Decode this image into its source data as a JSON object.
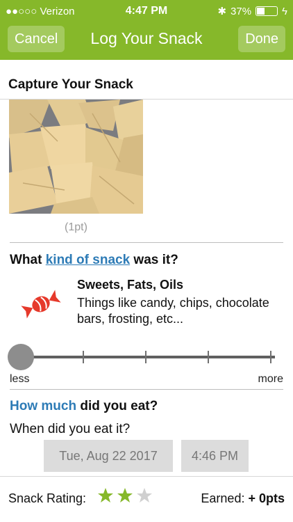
{
  "status": {
    "carrier": "●●○○○ Verizon",
    "time": "4:47 PM",
    "battery": "37%",
    "battery_level": 0.37
  },
  "nav": {
    "cancel": "Cancel",
    "title": "Log Your Snack",
    "done": "Done"
  },
  "capture": {
    "title": "Capture Your Snack",
    "points": "(1pt)"
  },
  "kind": {
    "prefix": "What ",
    "link": "kind of snack",
    "suffix": " was it?",
    "category_title": "Sweets, Fats, Oils",
    "category_desc": "Things like candy, chips, chocolate bars, frosting, etc..."
  },
  "amount": {
    "less": "less",
    "more": "more",
    "level": 0,
    "question_blue": "How much",
    "question_rest": " did you eat?"
  },
  "when": {
    "question": "When did you eat it?",
    "date": "Tue, Aug 22 2017",
    "time": "4:46 PM"
  },
  "footer": {
    "rating_label": "Snack Rating:",
    "stars_filled": 2,
    "stars_total": 3,
    "earned_label": "Earned:",
    "earned_value": "+ 0pts"
  },
  "colors": {
    "accent": "#86b82a",
    "link": "#2d7bb6",
    "candy": "#e6392b",
    "star_on": "#86b82a",
    "star_off": "#d0d0d0"
  }
}
